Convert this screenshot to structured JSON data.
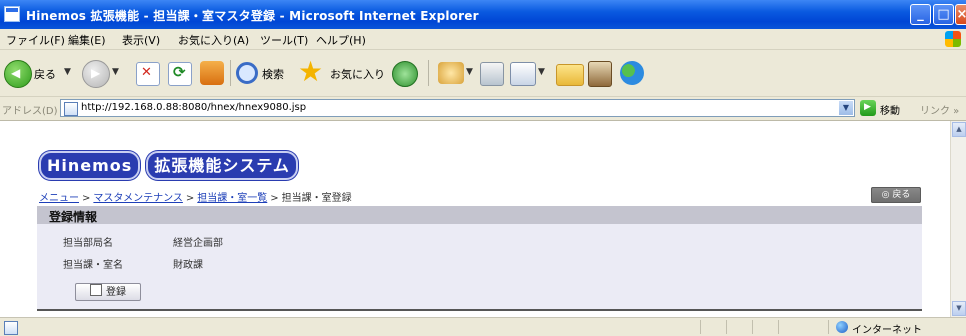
{
  "window": {
    "title": "Hinemos 拡張機能 - 担当課・室マスタ登録 - Microsoft Internet Explorer",
    "minimize": "_",
    "maximize": "□",
    "close": "×"
  },
  "menu": {
    "items": [
      "ファイル(F)",
      "編集(E)",
      "表示(V)",
      "お気に入り(A)",
      "ツール(T)",
      "ヘルプ(H)"
    ]
  },
  "toolbar": {
    "back_label": "戻る",
    "search_label": "検索",
    "favorites_label": "お気に入り",
    "dropdown_glyph": "▼"
  },
  "address": {
    "label": "アドレス(D)",
    "url": "http://192.168.0.88:8080/hnex/hnex9080.jsp",
    "go_label": "移動",
    "links_label": "リンク »"
  },
  "page": {
    "logo_parts": [
      "Hinemos",
      "拡張機能システム"
    ],
    "breadcrumb": {
      "links": [
        "メニュー",
        "マスタメンテナンス",
        "担当課・室一覧"
      ],
      "separator": ">",
      "current": "担当課・室登録"
    },
    "back_button": "◎ 戻る",
    "panel_title": "登録情報",
    "fields": [
      {
        "label": "担当部局名",
        "value": "経営企画部"
      },
      {
        "label": "担当課・室名",
        "value": "財政課"
      }
    ],
    "register_button": "登録"
  },
  "status": {
    "zone": "インターネット"
  }
}
